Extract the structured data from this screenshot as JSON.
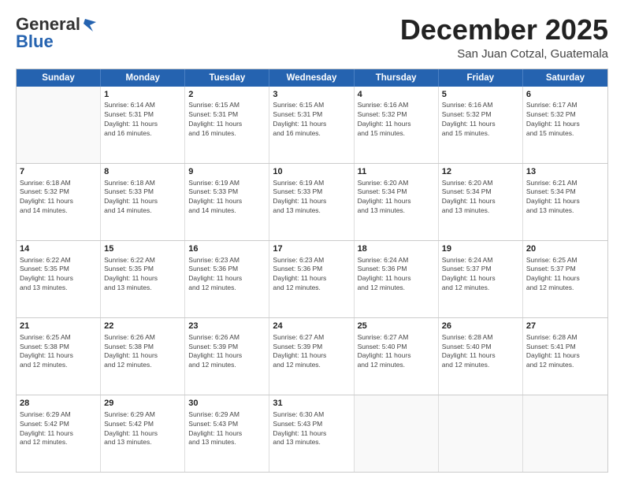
{
  "logo": {
    "line1": "General",
    "line2": "Blue"
  },
  "title": "December 2025",
  "subtitle": "San Juan Cotzal, Guatemala",
  "header_days": [
    "Sunday",
    "Monday",
    "Tuesday",
    "Wednesday",
    "Thursday",
    "Friday",
    "Saturday"
  ],
  "rows": [
    [
      {
        "day": "",
        "info": ""
      },
      {
        "day": "1",
        "info": "Sunrise: 6:14 AM\nSunset: 5:31 PM\nDaylight: 11 hours\nand 16 minutes."
      },
      {
        "day": "2",
        "info": "Sunrise: 6:15 AM\nSunset: 5:31 PM\nDaylight: 11 hours\nand 16 minutes."
      },
      {
        "day": "3",
        "info": "Sunrise: 6:15 AM\nSunset: 5:31 PM\nDaylight: 11 hours\nand 16 minutes."
      },
      {
        "day": "4",
        "info": "Sunrise: 6:16 AM\nSunset: 5:32 PM\nDaylight: 11 hours\nand 15 minutes."
      },
      {
        "day": "5",
        "info": "Sunrise: 6:16 AM\nSunset: 5:32 PM\nDaylight: 11 hours\nand 15 minutes."
      },
      {
        "day": "6",
        "info": "Sunrise: 6:17 AM\nSunset: 5:32 PM\nDaylight: 11 hours\nand 15 minutes."
      }
    ],
    [
      {
        "day": "7",
        "info": "Sunrise: 6:18 AM\nSunset: 5:32 PM\nDaylight: 11 hours\nand 14 minutes."
      },
      {
        "day": "8",
        "info": "Sunrise: 6:18 AM\nSunset: 5:33 PM\nDaylight: 11 hours\nand 14 minutes."
      },
      {
        "day": "9",
        "info": "Sunrise: 6:19 AM\nSunset: 5:33 PM\nDaylight: 11 hours\nand 14 minutes."
      },
      {
        "day": "10",
        "info": "Sunrise: 6:19 AM\nSunset: 5:33 PM\nDaylight: 11 hours\nand 13 minutes."
      },
      {
        "day": "11",
        "info": "Sunrise: 6:20 AM\nSunset: 5:34 PM\nDaylight: 11 hours\nand 13 minutes."
      },
      {
        "day": "12",
        "info": "Sunrise: 6:20 AM\nSunset: 5:34 PM\nDaylight: 11 hours\nand 13 minutes."
      },
      {
        "day": "13",
        "info": "Sunrise: 6:21 AM\nSunset: 5:34 PM\nDaylight: 11 hours\nand 13 minutes."
      }
    ],
    [
      {
        "day": "14",
        "info": "Sunrise: 6:22 AM\nSunset: 5:35 PM\nDaylight: 11 hours\nand 13 minutes."
      },
      {
        "day": "15",
        "info": "Sunrise: 6:22 AM\nSunset: 5:35 PM\nDaylight: 11 hours\nand 13 minutes."
      },
      {
        "day": "16",
        "info": "Sunrise: 6:23 AM\nSunset: 5:36 PM\nDaylight: 11 hours\nand 12 minutes."
      },
      {
        "day": "17",
        "info": "Sunrise: 6:23 AM\nSunset: 5:36 PM\nDaylight: 11 hours\nand 12 minutes."
      },
      {
        "day": "18",
        "info": "Sunrise: 6:24 AM\nSunset: 5:36 PM\nDaylight: 11 hours\nand 12 minutes."
      },
      {
        "day": "19",
        "info": "Sunrise: 6:24 AM\nSunset: 5:37 PM\nDaylight: 11 hours\nand 12 minutes."
      },
      {
        "day": "20",
        "info": "Sunrise: 6:25 AM\nSunset: 5:37 PM\nDaylight: 11 hours\nand 12 minutes."
      }
    ],
    [
      {
        "day": "21",
        "info": "Sunrise: 6:25 AM\nSunset: 5:38 PM\nDaylight: 11 hours\nand 12 minutes."
      },
      {
        "day": "22",
        "info": "Sunrise: 6:26 AM\nSunset: 5:38 PM\nDaylight: 11 hours\nand 12 minutes."
      },
      {
        "day": "23",
        "info": "Sunrise: 6:26 AM\nSunset: 5:39 PM\nDaylight: 11 hours\nand 12 minutes."
      },
      {
        "day": "24",
        "info": "Sunrise: 6:27 AM\nSunset: 5:39 PM\nDaylight: 11 hours\nand 12 minutes."
      },
      {
        "day": "25",
        "info": "Sunrise: 6:27 AM\nSunset: 5:40 PM\nDaylight: 11 hours\nand 12 minutes."
      },
      {
        "day": "26",
        "info": "Sunrise: 6:28 AM\nSunset: 5:40 PM\nDaylight: 11 hours\nand 12 minutes."
      },
      {
        "day": "27",
        "info": "Sunrise: 6:28 AM\nSunset: 5:41 PM\nDaylight: 11 hours\nand 12 minutes."
      }
    ],
    [
      {
        "day": "28",
        "info": "Sunrise: 6:29 AM\nSunset: 5:42 PM\nDaylight: 11 hours\nand 12 minutes."
      },
      {
        "day": "29",
        "info": "Sunrise: 6:29 AM\nSunset: 5:42 PM\nDaylight: 11 hours\nand 13 minutes."
      },
      {
        "day": "30",
        "info": "Sunrise: 6:29 AM\nSunset: 5:43 PM\nDaylight: 11 hours\nand 13 minutes."
      },
      {
        "day": "31",
        "info": "Sunrise: 6:30 AM\nSunset: 5:43 PM\nDaylight: 11 hours\nand 13 minutes."
      },
      {
        "day": "",
        "info": ""
      },
      {
        "day": "",
        "info": ""
      },
      {
        "day": "",
        "info": ""
      }
    ]
  ]
}
